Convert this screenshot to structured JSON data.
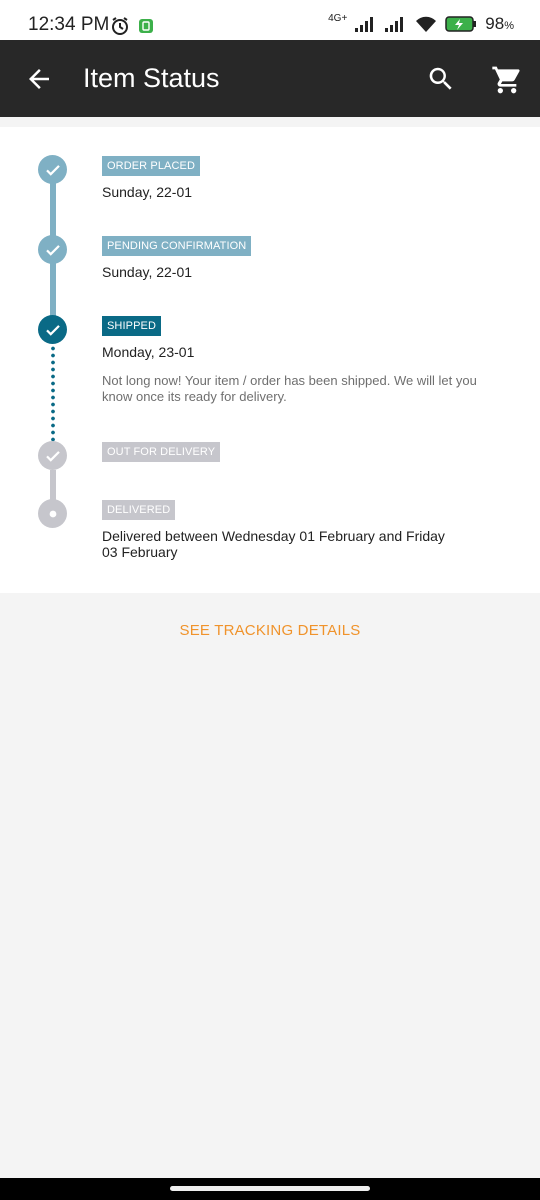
{
  "status_bar": {
    "time": "12:34 PM",
    "network": "4G+",
    "battery": "98",
    "battery_unit": "%"
  },
  "app_bar": {
    "title": "Item Status",
    "back_icon": "arrow-back-icon",
    "search_icon": "search-icon",
    "cart_icon": "cart-icon"
  },
  "colors": {
    "completed": "#7fb0c4",
    "current": "#0a6a86",
    "pending": "#c6c6cc",
    "accent": "#f0932b"
  },
  "timeline": [
    {
      "label": "ORDER PLACED",
      "date": "Sunday, 22-01",
      "state": "done"
    },
    {
      "label": "PENDING CONFIRMATION",
      "date": "Sunday, 22-01",
      "state": "done"
    },
    {
      "label": "SHIPPED",
      "date": "Monday, 23-01",
      "state": "current",
      "description": "Not long now! Your item / order has been shipped. We will let you know once its ready for delivery."
    },
    {
      "label": "OUT FOR DELIVERY",
      "state": "pending"
    },
    {
      "label": "DELIVERED",
      "date": "Delivered between Wednesday 01 February and Friday 03 February",
      "state": "pending"
    }
  ],
  "actions": {
    "tracking_label": "SEE TRACKING DETAILS"
  }
}
